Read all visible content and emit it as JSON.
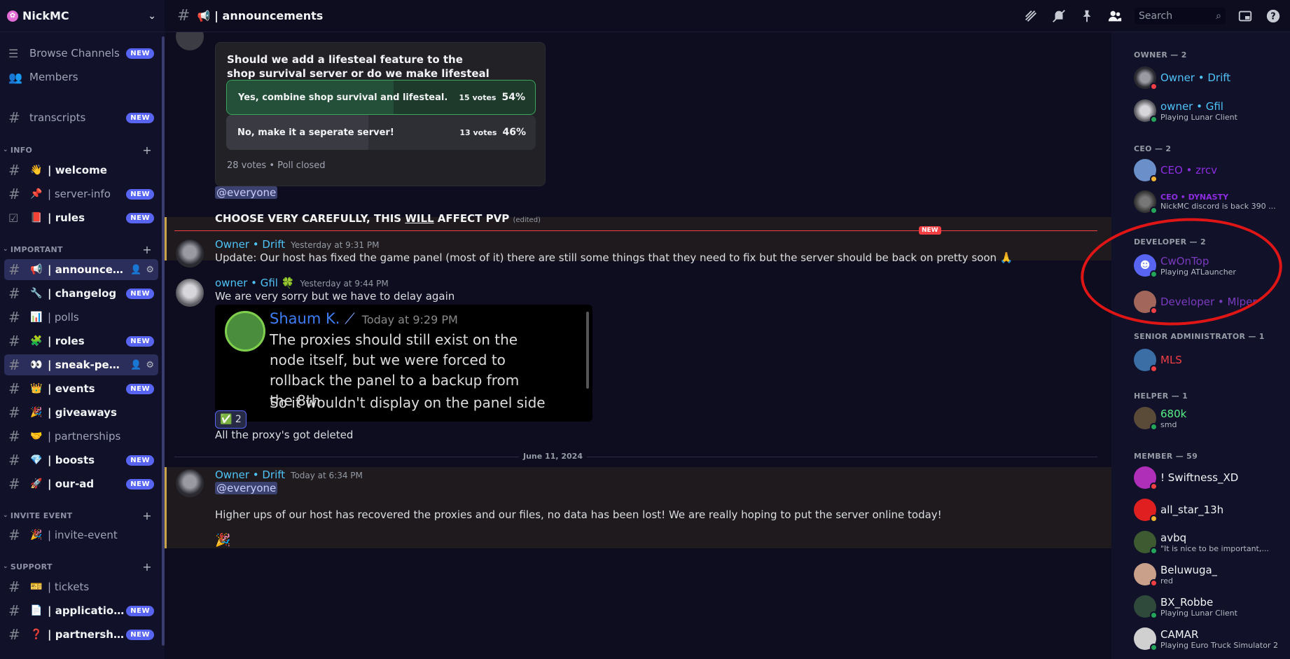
{
  "server": {
    "name": "NickMC"
  },
  "sidebar": {
    "top_items": [
      {
        "label": "Browse Channels",
        "badge": "NEW",
        "icon": "browse-icon"
      },
      {
        "label": "Members",
        "icon": "members-icon"
      }
    ],
    "transcripts": {
      "label": "transcripts",
      "badge": "NEW"
    },
    "categories": {
      "info": "INFO",
      "important": "IMPORTANT",
      "invite_event": "INVITE EVENT",
      "support": "SUPPORT"
    },
    "channels": {
      "welcome": {
        "emoji": "👋",
        "label": "| welcome"
      },
      "server_info": {
        "emoji": "📌",
        "label": "| server-info",
        "badge": "NEW"
      },
      "rules": {
        "emoji": "📕",
        "label": "| rules",
        "badge": "NEW"
      },
      "announcements": {
        "emoji": "📢",
        "label": "| announceme..."
      },
      "changelog": {
        "emoji": "🔧",
        "label": "| changelog",
        "badge": "NEW"
      },
      "polls": {
        "emoji": "📊",
        "label": "| polls"
      },
      "roles": {
        "emoji": "🧩",
        "label": "| roles",
        "badge": "NEW"
      },
      "sneak_peeks": {
        "emoji": "👀",
        "label": "| sneak-peeks"
      },
      "events": {
        "emoji": "👑",
        "label": "| events",
        "badge": "NEW"
      },
      "giveaways": {
        "emoji": "🎉",
        "label": "| giveaways"
      },
      "partnerships": {
        "emoji": "🤝",
        "label": "| partnerships"
      },
      "boosts": {
        "emoji": "💎",
        "label": "| boosts",
        "badge": "NEW"
      },
      "our_ad": {
        "emoji": "🚀",
        "label": "| our-ad",
        "badge": "NEW"
      },
      "invite_event": {
        "emoji": "🎉",
        "label": "| invite-event"
      },
      "tickets": {
        "emoji": "🎫",
        "label": "| tickets"
      },
      "applications": {
        "emoji": "📄",
        "label": "| applications",
        "badge": "NEW"
      },
      "partnership_apps": {
        "emoji": "❓",
        "label": "| partnership...",
        "badge": "NEW"
      }
    }
  },
  "topbar": {
    "emoji": "📢",
    "title": "| announcements",
    "search_placeholder": "Search",
    "icons": [
      "threads-icon",
      "mute-icon",
      "pin-icon",
      "members-toggle-icon",
      "inbox-icon",
      "help-icon"
    ]
  },
  "chat": {
    "poll": {
      "question": "Should we add a lifesteal feature to the shop survival server or do we make lifesteal a seperate server?",
      "options": [
        {
          "text": "Yes, combine shop survival and lifesteal.",
          "votes": "15 votes",
          "percent": "54%",
          "fraction": 0.54
        },
        {
          "text": "No, make it a seperate server!",
          "votes": "13 votes",
          "percent": "46%",
          "fraction": 0.46
        }
      ],
      "footer": "28 votes  •  Poll closed"
    },
    "msg1": {
      "mention": "@everyone",
      "text": "CHOOSE VERY CAREFULLY, THIS ",
      "underlined": "WILL",
      "text_after": " AFFECT PVP",
      "edited": "(edited)"
    },
    "new_tag": "NEW",
    "msg2": {
      "author": "Owner • Drift",
      "time": "Yesterday at 9:31 PM",
      "text": "Update: Our host has fixed the game panel (most of it) there are still some things that they need to fix but the server should be back on pretty soon",
      "emoji": "🙏"
    },
    "msg3": {
      "author": "owner • Gfil",
      "author_emoji": "🍀",
      "time": "Yesterday at 9:44 PM",
      "text": "We are very sorry but we have to delay again",
      "quote": {
        "author": "Shaum K.",
        "time": "Today at 9:29 PM",
        "body": "The proxies should still exist on the node itself, but we were forced to rollback the panel to a backup from the 8th",
        "body2": "So it wouldn't display on the panel side"
      },
      "reaction": {
        "emoji": "✅",
        "count": "2"
      },
      "text2": "All the proxy's got deleted"
    },
    "date_divider": "June 11, 2024",
    "msg4": {
      "author": "Owner • Drift",
      "time": "Today at 6:34 PM",
      "mention": "@everyone",
      "text": "Higher ups of our host has recovered the proxies and our files, no data has been lost! We are really hoping to put the server online today!",
      "emoji": "🎉"
    }
  },
  "members": {
    "groups": {
      "owner": "OWNER — 2",
      "ceo": "CEO — 2",
      "developer": "DEVELOPER — 2",
      "senior_admin": "SENIOR ADMINISTRATOR — 1",
      "helper": "HELPER — 1",
      "member": "MEMBER — 59"
    },
    "list": {
      "drift": {
        "name": "Owner • Drift",
        "color": "#4fc3f7"
      },
      "gfil": {
        "name": "owner • Gfil",
        "activity": "Playing Lunar Client",
        "color": "#4fc3f7"
      },
      "zrcv": {
        "name": "CEO • zrcv",
        "color": "#8d2de0"
      },
      "dynasty": {
        "name": "CEO • DYNASTY",
        "activity": "NickMC discord is back 390 ...",
        "color": "#8d2de0"
      },
      "cwontop": {
        "name": "CwOnTop",
        "activity": "Playing ATLauncher",
        "color": "#7a3bbf"
      },
      "mlper": {
        "name": "Developer • Mlper",
        "color": "#7a3bbf"
      },
      "mls": {
        "name": "MLS",
        "color": "#f23f43"
      },
      "k680": {
        "name": "680k",
        "activity": "smd",
        "color": "#57f287"
      },
      "swiftness": {
        "name": "! Swiftness_XD",
        "color": "#f2f3f5"
      },
      "allstar": {
        "name": "all_star_13h",
        "color": "#f2f3f5"
      },
      "avbq": {
        "name": "avbq",
        "activity": "\"It is nice to be important,...",
        "color": "#f2f3f5"
      },
      "beluwuga": {
        "name": "Beluwuga_",
        "activity": "red",
        "color": "#f2f3f5"
      },
      "bxrobbe": {
        "name": "BX_Robbe",
        "activity": "Playing Lunar Client",
        "color": "#f2f3f5"
      },
      "camar": {
        "name": "CAMAR",
        "activity": "Playing Euro Truck Simulator 2",
        "color": "#f2f3f5"
      }
    }
  },
  "colors": {
    "accent": "#5865f2",
    "mention_bar": "#c9a34a",
    "new_line": "#f23f43",
    "online": "#23a55a",
    "dnd": "#f23f43",
    "idle": "#f0b232",
    "annotation": "#e01515"
  }
}
